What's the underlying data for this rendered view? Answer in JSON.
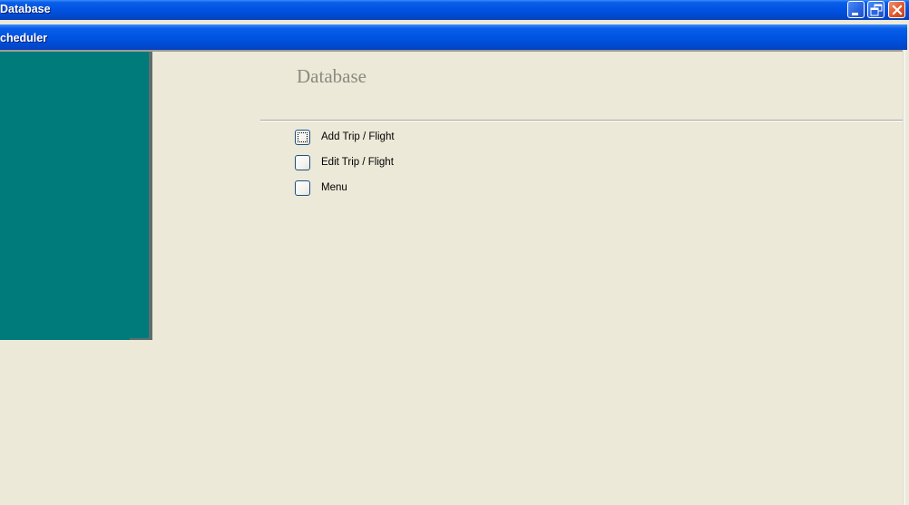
{
  "window": {
    "title": "Database",
    "controls": {
      "minimize": "minimize-icon",
      "restore": "restore-icon",
      "close": "close-icon"
    }
  },
  "child_window": {
    "title": "cheduler"
  },
  "colors": {
    "titlebar_blue": "#0054E3",
    "sidebar_teal": "#007B7B",
    "background": "#ECE9D8",
    "close_red": "#E0582E"
  },
  "main": {
    "heading": "Database",
    "items": [
      {
        "label": "Add Trip / Flight",
        "focused": true
      },
      {
        "label": "Edit Trip / Flight",
        "focused": false
      },
      {
        "label": "Menu",
        "focused": false
      }
    ]
  }
}
